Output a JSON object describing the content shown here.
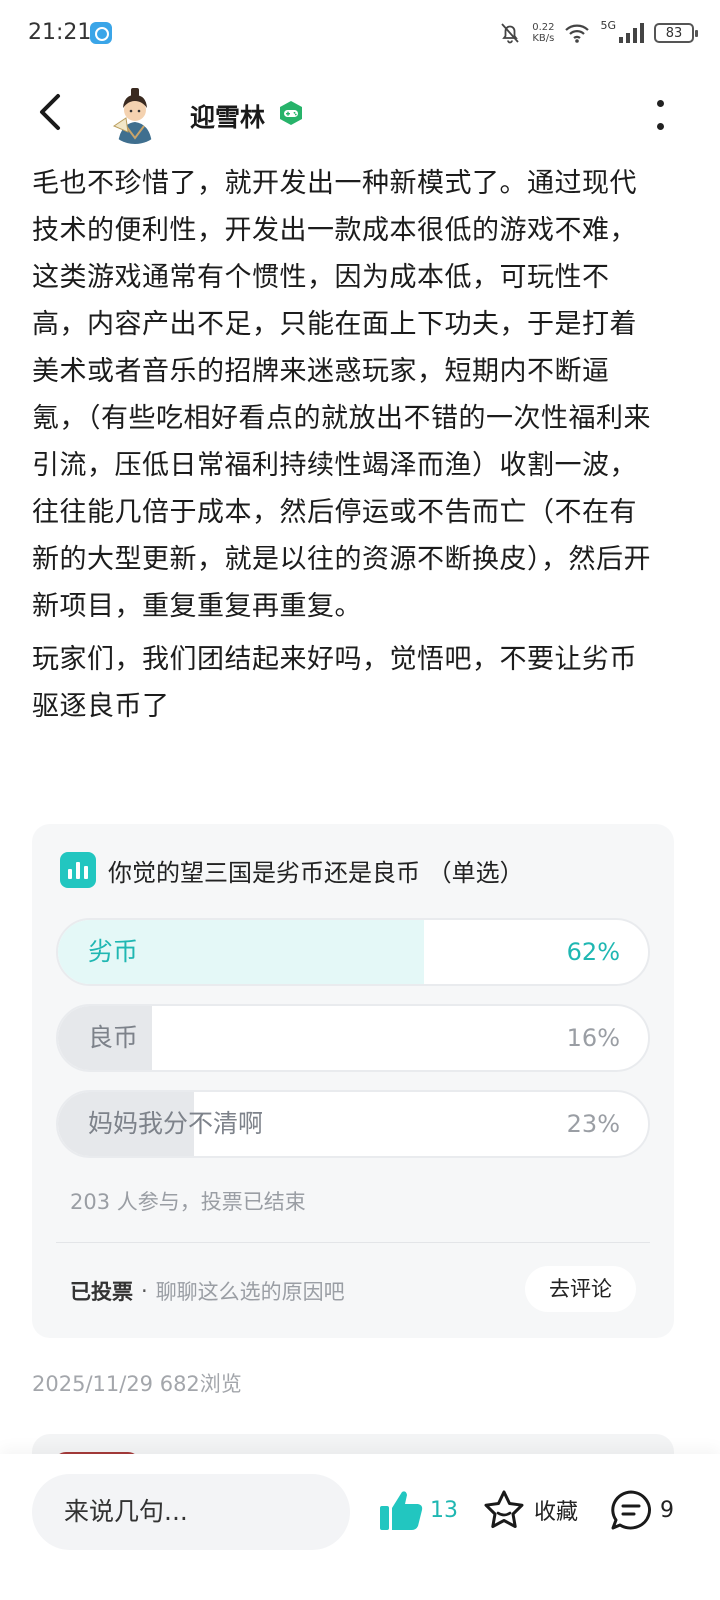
{
  "status_bar": {
    "time": "21:21",
    "net_speed_value": "0.22",
    "net_speed_unit": "KB/s",
    "network": "5G",
    "battery": "83"
  },
  "header": {
    "username": "迎雪林",
    "icons": [
      "back-arrow-icon",
      "game-controller-icon",
      "more-icon"
    ]
  },
  "article": {
    "paragraph1": "毛也不珍惜了，就开发出一种新模式了。通过现代技术的便利性，开发出一款成本很低的游戏不难，这类游戏通常有个惯性，因为成本低，可玩性不高，内容产出不足，只能在面上下功夫，于是打着美术或者音乐的招牌来迷惑玩家，短期内不断逼氪，（有些吃相好看点的就放出不错的一次性福利来引流，压低日常福利持续性竭泽而渔）收割一波，往往能几倍于成本，然后停运或不告而亡（不在有新的大型更新，就是以往的资源不断换皮），然后开新项目，重复重复再重复。",
    "paragraph2": "玩家们，我们团结起来好吗，觉悟吧，不要让劣币驱逐良币了"
  },
  "poll": {
    "title": "你觉的望三国是劣币还是良币 （单选）",
    "options": [
      {
        "label": "劣币",
        "percent": "62%",
        "fraction": 0.62,
        "selected": true
      },
      {
        "label": "良币",
        "percent": "16%",
        "fraction": 0.16,
        "selected": false
      },
      {
        "label": "妈妈我分不清啊",
        "percent": "23%",
        "fraction": 0.23,
        "selected": false
      }
    ],
    "meta": "203 人参与，投票已结束",
    "voted_label": "已投票",
    "separator": "·",
    "reason_prompt": "聊聊这么选的原因吧",
    "comment_button": "去评论",
    "colors": {
      "selected_fill": "#e4f8f7",
      "unselected_fill": "#e6e8eb",
      "accent": "#1fb7b2"
    }
  },
  "post_meta": "2025/11/29  682浏览",
  "bottom_bar": {
    "comment_placeholder": "来说几句...",
    "like_count": "13",
    "favorite_label": "收藏",
    "comment_count": "9"
  }
}
